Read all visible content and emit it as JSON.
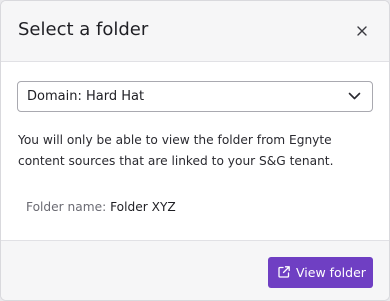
{
  "dialog": {
    "title": "Select a folder",
    "close_icon": "close-icon"
  },
  "folder_select": {
    "selected_value": "Domain: Hard Hat",
    "icon": "chevron-down-icon"
  },
  "info": {
    "line1": "You will only be able to view the folder from Egnyte",
    "line2": "content sources that are linked to your S&G tenant."
  },
  "folder": {
    "label": "Folder name:",
    "value": "Folder XYZ"
  },
  "footer": {
    "view_button_label": "View folder",
    "view_button_icon": "external-link-icon"
  },
  "colors": {
    "primary_button": "#6f3fc3",
    "header_bg": "#f6f6f7",
    "border": "#e1e1e5",
    "text": "#1f1f24",
    "muted_text": "#6b6b73"
  }
}
